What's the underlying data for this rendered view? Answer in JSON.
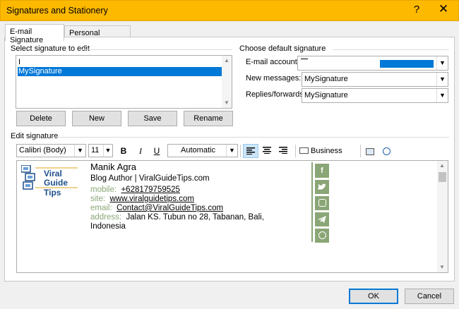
{
  "window": {
    "title": "Signatures and Stationery",
    "help_glyph": "?",
    "close_glyph": "✕"
  },
  "tabs": [
    {
      "label": "E-mail Signature",
      "active": true
    },
    {
      "label": "Personal Stationery",
      "active": false
    }
  ],
  "select_signature": {
    "heading": "Select signature to edit",
    "items": [
      {
        "label": "I",
        "selected": false
      },
      {
        "label": "MySignature",
        "selected": true
      }
    ],
    "buttons": {
      "delete": "Delete",
      "new": "New",
      "save": "Save",
      "rename": "Rename"
    }
  },
  "default_signature": {
    "heading": "Choose default signature",
    "email_account_label": "E-mail account:",
    "new_messages_label": "New messages:",
    "new_messages_value": "MySignature",
    "replies_label": "Replies/forwards:",
    "replies_value": "MySignature"
  },
  "edit_signature": {
    "heading": "Edit signature",
    "font": "Calibri (Body)",
    "size": "11",
    "bold": "B",
    "italic": "I",
    "underline": "U",
    "color": "Automatic",
    "business_card": "Business Card"
  },
  "signature": {
    "logo_line1": "Viral",
    "logo_line2": "Guide Tips",
    "name": "Manik Agra",
    "role": "Blog Author | ViralGuideTips.com",
    "mobile_label": "mobile:",
    "mobile": "+628179759525",
    "site_label": "site:",
    "site": "www.viralguidetips.com",
    "email_label": "email:",
    "email": "Contact@ViralGuideTips.com",
    "address_label": "address:",
    "address_line1": "Jalan KS. Tubun no 28, Tabanan, Bali,",
    "address_line2": "Indonesia",
    "accent_color": "#8aa676",
    "social_icons": [
      "facebook-icon",
      "twitter-icon",
      "instagram-icon",
      "telegram-icon",
      "whatsapp-icon"
    ]
  },
  "footer": {
    "ok": "OK",
    "cancel": "Cancel"
  }
}
